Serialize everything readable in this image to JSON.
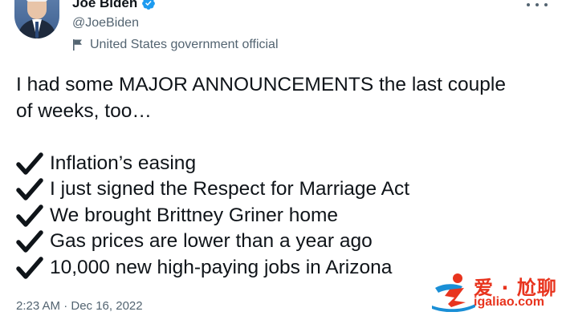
{
  "author": {
    "display_name": "Joe Biden",
    "handle": "@JoeBiden",
    "label": "United States government official",
    "verified": true,
    "verified_color": "#1d9bf0"
  },
  "tweet": {
    "intro_line1": "I had some MAJOR ANNOUNCEMENTS the last couple",
    "intro_line2": "of weeks, too…",
    "checklist": [
      "Inflation’s easing",
      "I just signed the Respect for Marriage Act",
      "We brought Brittney Griner home",
      "Gas prices are lower than a year ago",
      "10,000 new high-paying jobs in Arizona"
    ],
    "timestamp": "2:23 AM · Dec 16, 2022"
  },
  "icons": {
    "more": "more-options-icon",
    "verified": "verified-badge-icon",
    "label": "flag-icon",
    "check": "heavy-check-mark-icon"
  },
  "watermark": {
    "brand_cn": "爱 · 尬聊",
    "url": "igaliao.com",
    "color": "#e8341e"
  },
  "colors": {
    "text_primary": "#0f1419",
    "text_secondary": "#536471"
  }
}
